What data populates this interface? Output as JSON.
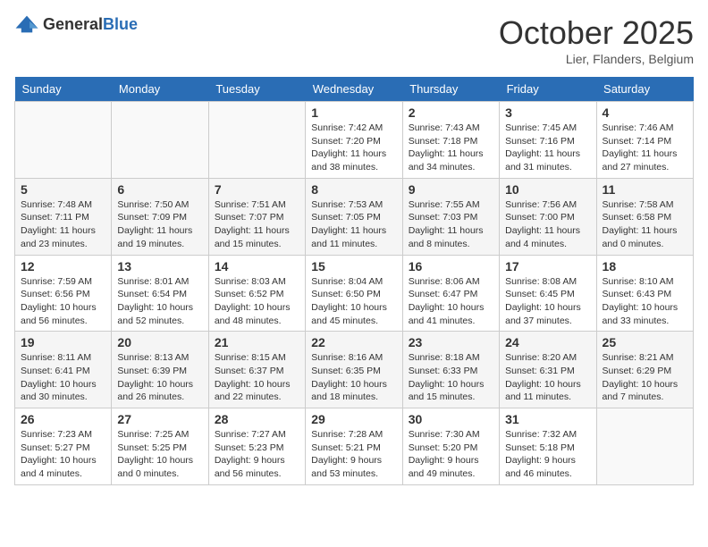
{
  "header": {
    "logo_general": "General",
    "logo_blue": "Blue",
    "month": "October 2025",
    "location": "Lier, Flanders, Belgium"
  },
  "days_of_week": [
    "Sunday",
    "Monday",
    "Tuesday",
    "Wednesday",
    "Thursday",
    "Friday",
    "Saturday"
  ],
  "weeks": [
    [
      {
        "day": "",
        "info": ""
      },
      {
        "day": "",
        "info": ""
      },
      {
        "day": "",
        "info": ""
      },
      {
        "day": "1",
        "info": "Sunrise: 7:42 AM\nSunset: 7:20 PM\nDaylight: 11 hours and 38 minutes."
      },
      {
        "day": "2",
        "info": "Sunrise: 7:43 AM\nSunset: 7:18 PM\nDaylight: 11 hours and 34 minutes."
      },
      {
        "day": "3",
        "info": "Sunrise: 7:45 AM\nSunset: 7:16 PM\nDaylight: 11 hours and 31 minutes."
      },
      {
        "day": "4",
        "info": "Sunrise: 7:46 AM\nSunset: 7:14 PM\nDaylight: 11 hours and 27 minutes."
      }
    ],
    [
      {
        "day": "5",
        "info": "Sunrise: 7:48 AM\nSunset: 7:11 PM\nDaylight: 11 hours and 23 minutes."
      },
      {
        "day": "6",
        "info": "Sunrise: 7:50 AM\nSunset: 7:09 PM\nDaylight: 11 hours and 19 minutes."
      },
      {
        "day": "7",
        "info": "Sunrise: 7:51 AM\nSunset: 7:07 PM\nDaylight: 11 hours and 15 minutes."
      },
      {
        "day": "8",
        "info": "Sunrise: 7:53 AM\nSunset: 7:05 PM\nDaylight: 11 hours and 11 minutes."
      },
      {
        "day": "9",
        "info": "Sunrise: 7:55 AM\nSunset: 7:03 PM\nDaylight: 11 hours and 8 minutes."
      },
      {
        "day": "10",
        "info": "Sunrise: 7:56 AM\nSunset: 7:00 PM\nDaylight: 11 hours and 4 minutes."
      },
      {
        "day": "11",
        "info": "Sunrise: 7:58 AM\nSunset: 6:58 PM\nDaylight: 11 hours and 0 minutes."
      }
    ],
    [
      {
        "day": "12",
        "info": "Sunrise: 7:59 AM\nSunset: 6:56 PM\nDaylight: 10 hours and 56 minutes."
      },
      {
        "day": "13",
        "info": "Sunrise: 8:01 AM\nSunset: 6:54 PM\nDaylight: 10 hours and 52 minutes."
      },
      {
        "day": "14",
        "info": "Sunrise: 8:03 AM\nSunset: 6:52 PM\nDaylight: 10 hours and 48 minutes."
      },
      {
        "day": "15",
        "info": "Sunrise: 8:04 AM\nSunset: 6:50 PM\nDaylight: 10 hours and 45 minutes."
      },
      {
        "day": "16",
        "info": "Sunrise: 8:06 AM\nSunset: 6:47 PM\nDaylight: 10 hours and 41 minutes."
      },
      {
        "day": "17",
        "info": "Sunrise: 8:08 AM\nSunset: 6:45 PM\nDaylight: 10 hours and 37 minutes."
      },
      {
        "day": "18",
        "info": "Sunrise: 8:10 AM\nSunset: 6:43 PM\nDaylight: 10 hours and 33 minutes."
      }
    ],
    [
      {
        "day": "19",
        "info": "Sunrise: 8:11 AM\nSunset: 6:41 PM\nDaylight: 10 hours and 30 minutes."
      },
      {
        "day": "20",
        "info": "Sunrise: 8:13 AM\nSunset: 6:39 PM\nDaylight: 10 hours and 26 minutes."
      },
      {
        "day": "21",
        "info": "Sunrise: 8:15 AM\nSunset: 6:37 PM\nDaylight: 10 hours and 22 minutes."
      },
      {
        "day": "22",
        "info": "Sunrise: 8:16 AM\nSunset: 6:35 PM\nDaylight: 10 hours and 18 minutes."
      },
      {
        "day": "23",
        "info": "Sunrise: 8:18 AM\nSunset: 6:33 PM\nDaylight: 10 hours and 15 minutes."
      },
      {
        "day": "24",
        "info": "Sunrise: 8:20 AM\nSunset: 6:31 PM\nDaylight: 10 hours and 11 minutes."
      },
      {
        "day": "25",
        "info": "Sunrise: 8:21 AM\nSunset: 6:29 PM\nDaylight: 10 hours and 7 minutes."
      }
    ],
    [
      {
        "day": "26",
        "info": "Sunrise: 7:23 AM\nSunset: 5:27 PM\nDaylight: 10 hours and 4 minutes."
      },
      {
        "day": "27",
        "info": "Sunrise: 7:25 AM\nSunset: 5:25 PM\nDaylight: 10 hours and 0 minutes."
      },
      {
        "day": "28",
        "info": "Sunrise: 7:27 AM\nSunset: 5:23 PM\nDaylight: 9 hours and 56 minutes."
      },
      {
        "day": "29",
        "info": "Sunrise: 7:28 AM\nSunset: 5:21 PM\nDaylight: 9 hours and 53 minutes."
      },
      {
        "day": "30",
        "info": "Sunrise: 7:30 AM\nSunset: 5:20 PM\nDaylight: 9 hours and 49 minutes."
      },
      {
        "day": "31",
        "info": "Sunrise: 7:32 AM\nSunset: 5:18 PM\nDaylight: 9 hours and 46 minutes."
      },
      {
        "day": "",
        "info": ""
      }
    ]
  ]
}
